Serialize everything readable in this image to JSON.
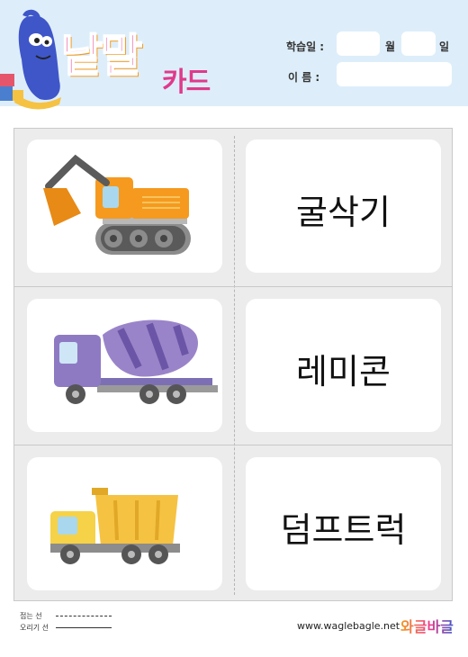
{
  "header": {
    "logo_main": "낱말",
    "logo_sub": "카드",
    "date_label": "학습일 :",
    "month_label": "월",
    "day_label": "일",
    "name_label": "이   름 :"
  },
  "cards": [
    {
      "word": "굴삭기",
      "image": "excavator"
    },
    {
      "word": "레미콘",
      "image": "concrete-mixer-truck"
    },
    {
      "word": "덤프트럭",
      "image": "dump-truck"
    }
  ],
  "footer": {
    "fold_line_label": "접는 선",
    "cut_line_label": "오리기 선",
    "website": "www.waglebagle.net",
    "brand_name": "와글바글"
  },
  "colors": {
    "header_bg": "#ddeefa",
    "logo_orange": "#f49a1c",
    "logo_pink": "#ec3d8c",
    "card_bg": "#ececec"
  }
}
